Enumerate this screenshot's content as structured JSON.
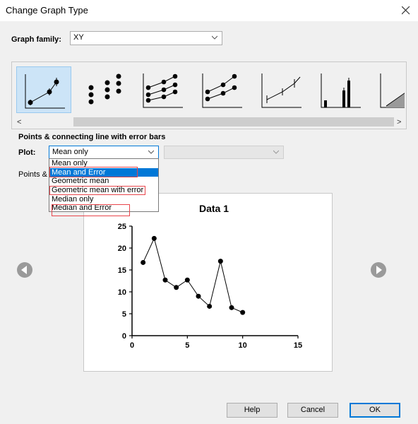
{
  "window": {
    "title": "Change Graph Type"
  },
  "graph_family": {
    "label": "Graph family:",
    "value": "XY"
  },
  "gallery": {
    "thumbnails": [
      {
        "name": "points-line-error-bars",
        "selected": true
      },
      {
        "name": "points-only",
        "selected": false
      },
      {
        "name": "points-connected-series",
        "selected": false
      },
      {
        "name": "points-connected-two",
        "selected": false
      },
      {
        "name": "line-error-bars",
        "selected": false
      },
      {
        "name": "spikes",
        "selected": false
      },
      {
        "name": "area-fill",
        "selected": false
      }
    ],
    "scroll_left": "<",
    "scroll_right": ">"
  },
  "section_heading": "Points & connecting line with error bars",
  "plot": {
    "label": "Plot:",
    "value": "Mean only",
    "secondary_value": "",
    "options": [
      "Mean only",
      "Mean and Error",
      "Geometric mean",
      "Geometric mean with error",
      "Median only",
      "Median and Error"
    ],
    "highlighted": "Mean and Error"
  },
  "description": "Points & connecting line with error bars",
  "preview": {
    "title": "Data 1",
    "x_ticks": [
      "0",
      "5",
      "10",
      "15"
    ],
    "y_ticks": [
      "0",
      "5",
      "10",
      "15",
      "20",
      "25"
    ]
  },
  "chart_data": {
    "type": "line",
    "title": "Data 1",
    "xlabel": "",
    "ylabel": "",
    "xlim": [
      0,
      15
    ],
    "ylim": [
      0,
      25
    ],
    "x": [
      1,
      2,
      3,
      4,
      5,
      6,
      7,
      8,
      9,
      10
    ],
    "series": [
      {
        "values": [
          16.7,
          22.2,
          12.7,
          11.0,
          12.7,
          9.0,
          6.7,
          17.0,
          6.4,
          5.3
        ]
      }
    ]
  },
  "buttons": {
    "help": "Help",
    "cancel": "Cancel",
    "ok": "OK"
  },
  "colors": {
    "selection": "#0078d7",
    "annotation": "#e8454b",
    "thumb_selected_bg": "#cce4f7"
  }
}
